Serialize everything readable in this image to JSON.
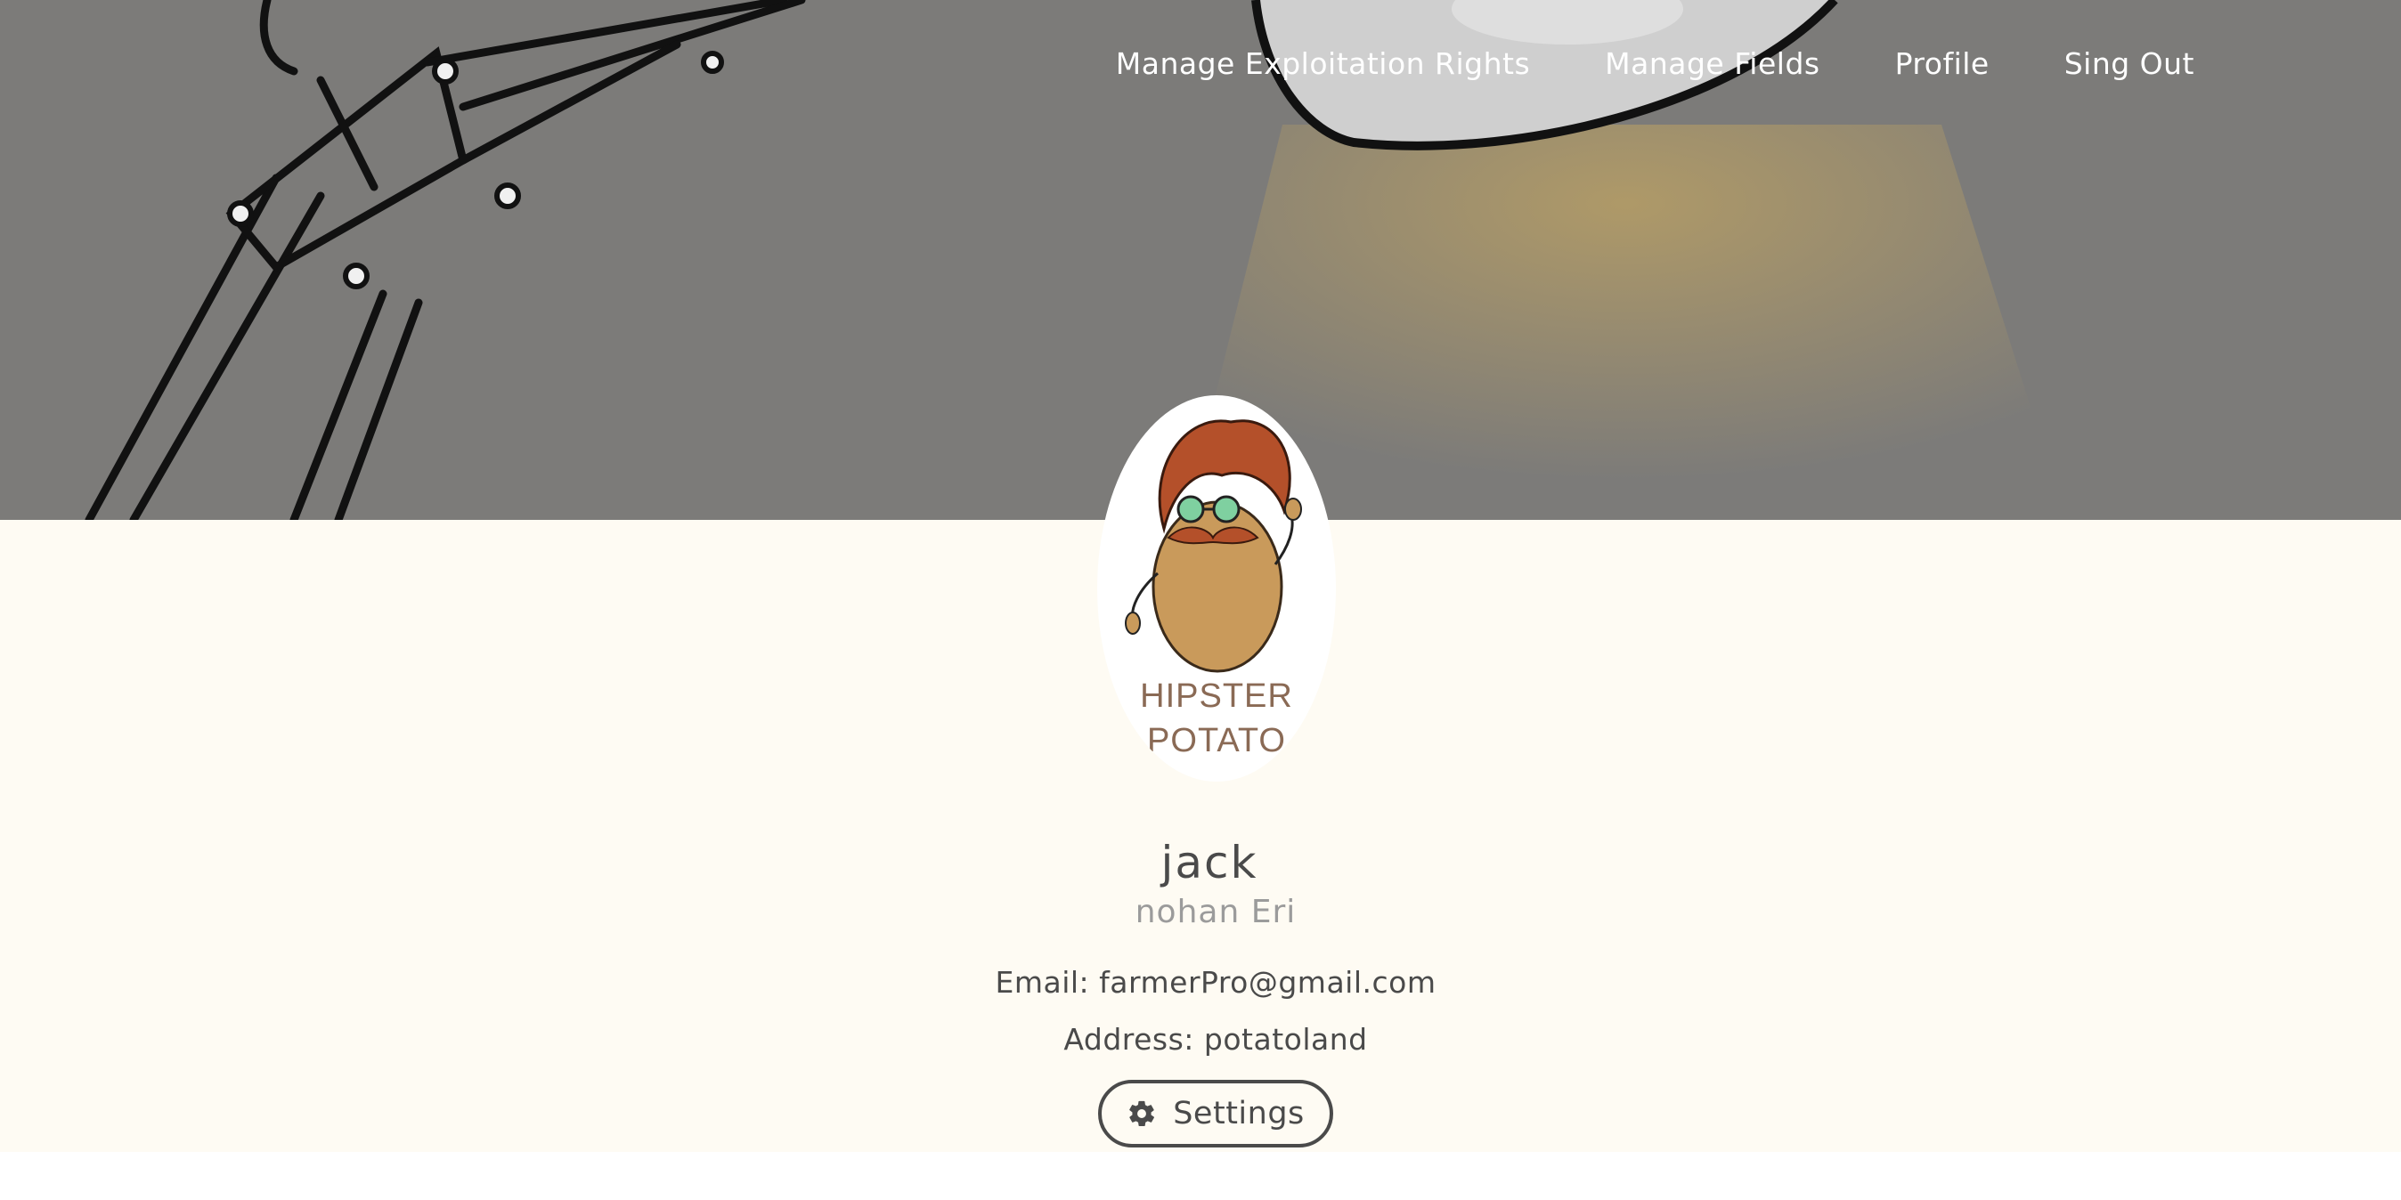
{
  "nav": {
    "items": [
      {
        "label": "Manage Exploitation Rights"
      },
      {
        "label": "Manage Fields"
      },
      {
        "label": "Profile"
      },
      {
        "label": "Sing Out"
      }
    ]
  },
  "avatar": {
    "logo_text_line1": "HIPSTER",
    "logo_text_line2": "POTATO"
  },
  "profile": {
    "username": "jack",
    "full_name": "nohan Eri",
    "email": "Email: farmerPro@gmail.com",
    "address": "Address: potatoland"
  },
  "actions": {
    "settings_label": "Settings",
    "settings_icon": "gear-icon"
  },
  "colors": {
    "hero_bg": "#7c7b79",
    "content_bg": "#fefbf3",
    "text_primary": "#4a4a4a",
    "text_secondary": "#9b9b9b"
  }
}
